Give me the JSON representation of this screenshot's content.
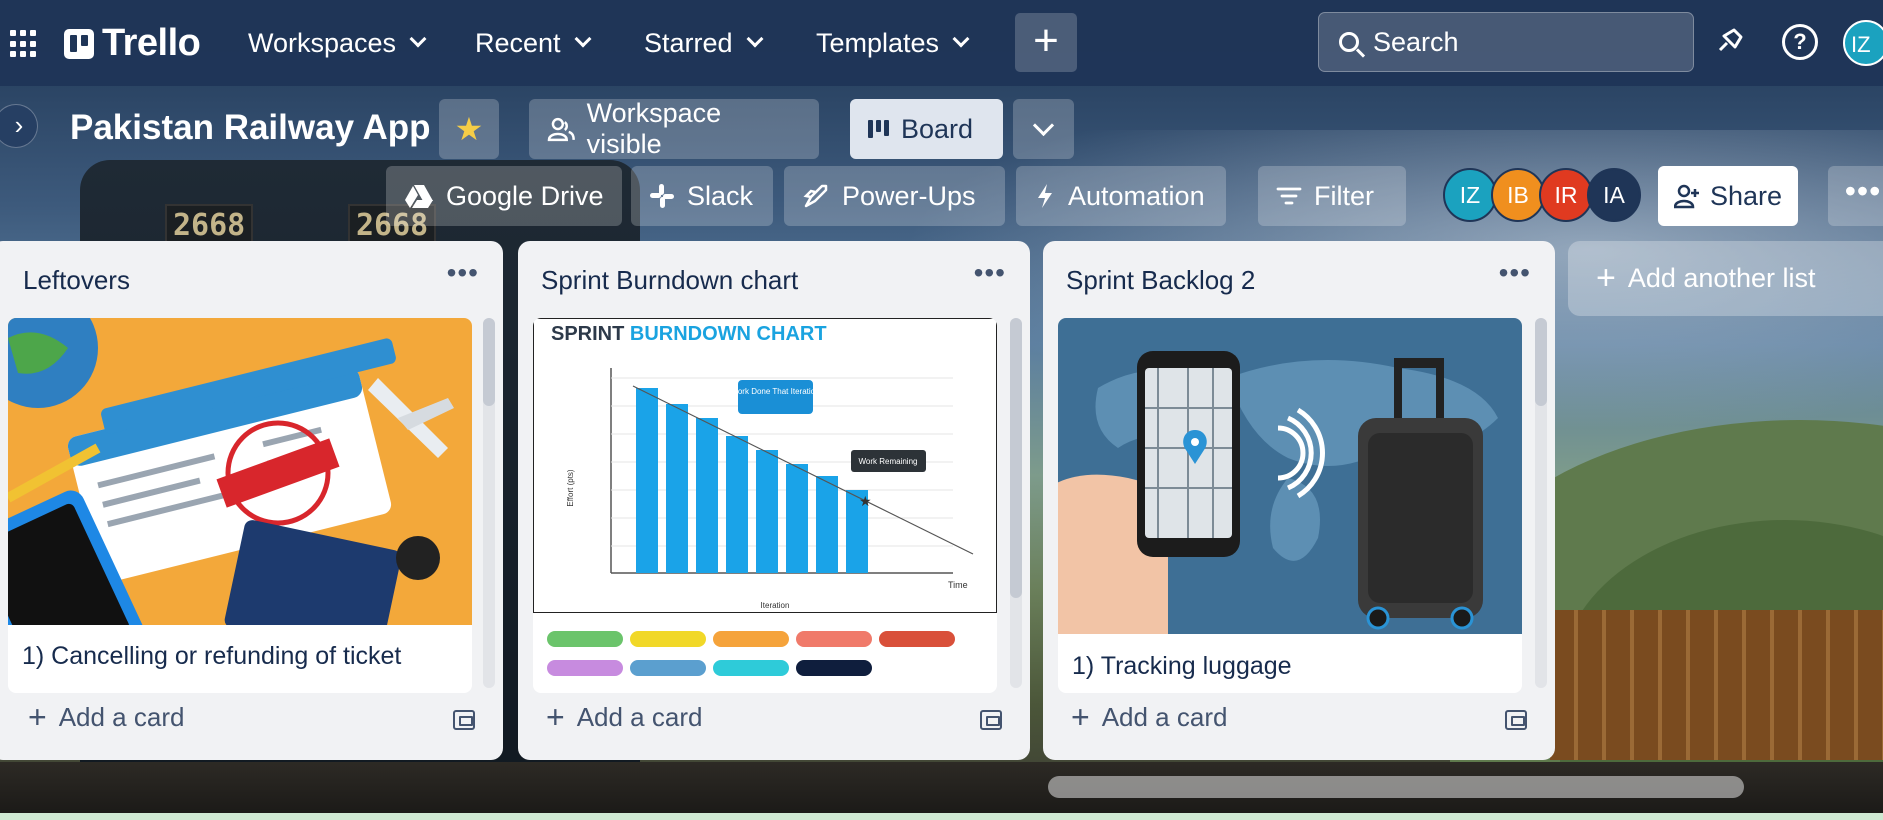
{
  "header": {
    "logo_text": "Trello",
    "nav": [
      {
        "label": "Workspaces"
      },
      {
        "label": "Recent"
      },
      {
        "label": "Starred"
      },
      {
        "label": "Templates"
      }
    ],
    "create_label": "+",
    "search_placeholder": "Search",
    "user_initials": "IZ"
  },
  "board": {
    "title": "Pakistan Railway App",
    "visibility_label": "Workspace visible",
    "view_label": "Board",
    "toolbar": [
      {
        "label": "Google Drive"
      },
      {
        "label": "Slack"
      },
      {
        "label": "Power-Ups"
      },
      {
        "label": "Automation"
      },
      {
        "label": "Filter"
      }
    ],
    "members": [
      {
        "initials": "IZ",
        "color": "#1ba2bf"
      },
      {
        "initials": "IB",
        "color": "#f08f1e"
      },
      {
        "initials": "IR",
        "color": "#e03a20"
      },
      {
        "initials": "IA",
        "color": "#1f3557"
      }
    ],
    "share_label": "Share",
    "add_list_label": "Add another list"
  },
  "lists": [
    {
      "title": "Leftovers",
      "card_title": "1) Cancelling or refunding of ticket",
      "add_card_label": "Add a card"
    },
    {
      "title": "Sprint Burndown chart",
      "add_card_label": "Add a card",
      "labels": [
        "#6bc46b",
        "#f1d828",
        "#f5a33b",
        "#f07a6a",
        "#d9503a",
        "#c78bdf",
        "#5b9fcf",
        "#2ecbd9",
        "#0f1e3d"
      ]
    },
    {
      "title": "Sprint Backlog 2",
      "card_title": "1) Tracking luggage",
      "add_card_label": "Add a card"
    }
  ],
  "burndown": {
    "heading_a": "SPRINT",
    "heading_b": "BURNDOWN CHART",
    "ylabel": "Effort (pts)",
    "xlabel": "Iteration",
    "x_axis_end": "Time",
    "bubble_1": "Work Done\nThat Iteration",
    "bubble_2": "Work Remaining"
  },
  "background": {
    "loco_numbers": [
      "2668",
      "2668"
    ]
  }
}
